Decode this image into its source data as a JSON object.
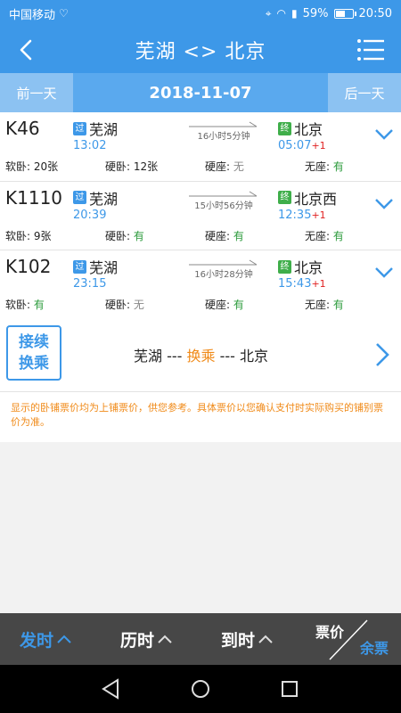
{
  "status": {
    "carrier": "中国移动",
    "battery": "59%",
    "time": "20:50",
    "battery_level": 0.59
  },
  "header": {
    "title": "芜湖 <> 北京"
  },
  "datebar": {
    "prev": "前一天",
    "date": "2018-11-07",
    "next": "后一天"
  },
  "badges": {
    "pass": "过",
    "end": "终"
  },
  "trains": [
    {
      "code": "K46",
      "from": "芜湖",
      "dep": "13:02",
      "duration": "16小时5分钟",
      "to": "北京",
      "arr": "05:07",
      "plus": "+1",
      "seats": [
        {
          "label": "软卧: ",
          "value": "20张",
          "state": "count"
        },
        {
          "label": "硬卧: ",
          "value": "12张",
          "state": "count"
        },
        {
          "label": "硬座: ",
          "value": "无",
          "state": "no"
        },
        {
          "label": "无座: ",
          "value": "有",
          "state": "ok"
        }
      ]
    },
    {
      "code": "K1110",
      "from": "芜湖",
      "dep": "20:39",
      "duration": "15小时56分钟",
      "to": "北京西",
      "arr": "12:35",
      "plus": "+1",
      "seats": [
        {
          "label": "软卧: ",
          "value": "9张",
          "state": "count"
        },
        {
          "label": "硬卧: ",
          "value": "有",
          "state": "ok"
        },
        {
          "label": "硬座: ",
          "value": "有",
          "state": "ok"
        },
        {
          "label": "无座: ",
          "value": "有",
          "state": "ok"
        }
      ]
    },
    {
      "code": "K102",
      "from": "芜湖",
      "dep": "23:15",
      "duration": "16小时28分钟",
      "to": "北京",
      "arr": "15:43",
      "plus": "+1",
      "seats": [
        {
          "label": "软卧: ",
          "value": "有",
          "state": "ok"
        },
        {
          "label": "硬卧: ",
          "value": "无",
          "state": "no"
        },
        {
          "label": "硬座: ",
          "value": "有",
          "state": "ok"
        },
        {
          "label": "无座: ",
          "value": "有",
          "state": "ok"
        }
      ]
    }
  ],
  "transfer": {
    "button_line1": "接续",
    "button_line2": "换乘",
    "from": "芜湖",
    "sep1": " --- ",
    "mid": "换乘",
    "sep2": " --- ",
    "to": "北京"
  },
  "notice": "显示的卧铺票价均为上铺票价，供您参考。具体票价以您确认支付时实际购买的铺别票价为准。",
  "sortbar": {
    "depart": "发时",
    "duration": "历时",
    "arrive": "到时",
    "price": "票价",
    "remaining": "余票"
  },
  "colors": {
    "primary": "#3d98e8",
    "available": "#2a9a3a",
    "unavailable": "#888888",
    "accent": "#f08a18",
    "overnight": "#e02020"
  }
}
